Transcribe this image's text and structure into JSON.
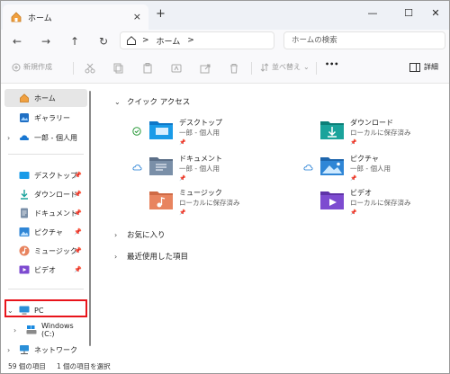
{
  "tab": {
    "title": "ホーム",
    "close": "×",
    "new": "+"
  },
  "window_controls": {
    "minimize": "—",
    "maximize": "☐",
    "close": "✕"
  },
  "nav": {
    "back": "←",
    "forward": "→",
    "up": "↑",
    "refresh": "↻"
  },
  "address": {
    "segments": [
      "ホーム",
      ">"
    ],
    "separator": ">"
  },
  "search": {
    "placeholder": "ホームの検索"
  },
  "commands": {
    "new": "新規作成",
    "sort": "並べ替え",
    "more": "•••",
    "details": "詳細"
  },
  "sidebar": {
    "items": [
      {
        "label": "ホーム",
        "icon": "home-icon"
      },
      {
        "label": "ギャラリー",
        "icon": "gallery-icon"
      },
      {
        "label": "一郎 - 個人用",
        "icon": "cloud-icon"
      },
      {
        "label": "デスクトップ",
        "icon": "desktop-icon"
      },
      {
        "label": "ダウンロード",
        "icon": "download-icon"
      },
      {
        "label": "ドキュメント",
        "icon": "document-icon"
      },
      {
        "label": "ピクチャ",
        "icon": "picture-icon"
      },
      {
        "label": "ミュージック",
        "icon": "music-icon"
      },
      {
        "label": "ビデオ",
        "icon": "video-icon"
      },
      {
        "label": "PC",
        "icon": "pc-icon"
      },
      {
        "label": "Windows (C:)",
        "icon": "drive-icon"
      },
      {
        "label": "ネットワーク",
        "icon": "network-icon"
      }
    ]
  },
  "main": {
    "quick_access": "クイック アクセス",
    "favorites": "お気に入り",
    "recent": "最近使用した項目",
    "folders": [
      {
        "name": "デスクトップ",
        "sub": "一郎 - 個人用",
        "color": "#1a9be8"
      },
      {
        "name": "ダウンロード",
        "sub": "ローカルに保存済み",
        "color": "#1aa39b"
      },
      {
        "name": "ドキュメント",
        "sub": "一郎 - 個人用",
        "color": "#7a8fa8"
      },
      {
        "name": "ピクチャ",
        "sub": "一郎 - 個人用",
        "color": "#2f86d6"
      },
      {
        "name": "ミュージック",
        "sub": "ローカルに保存済み",
        "color": "#e8845f"
      },
      {
        "name": "ビデオ",
        "sub": "ローカルに保存済み",
        "color": "#7d4bd0"
      }
    ]
  },
  "status": {
    "count": "59 個の項目",
    "selected": "1 個の項目を選択"
  }
}
